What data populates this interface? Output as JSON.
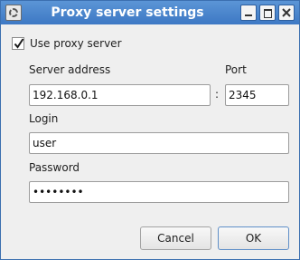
{
  "window": {
    "title": "Proxy server settings",
    "title_bar_color": "#4a86cc",
    "buttons": [
      "minimize",
      "maximize",
      "close"
    ]
  },
  "use_proxy": {
    "label": "Use proxy server",
    "checked": true
  },
  "server": {
    "address_label": "Server address",
    "address_value": "192.168.0.1",
    "separator": ":",
    "port_label": "Port",
    "port_value": "2345"
  },
  "login": {
    "label": "Login",
    "value": "user"
  },
  "password": {
    "label": "Password",
    "value": "••••••••"
  },
  "actions": {
    "cancel_label": "Cancel",
    "ok_label": "OK"
  }
}
